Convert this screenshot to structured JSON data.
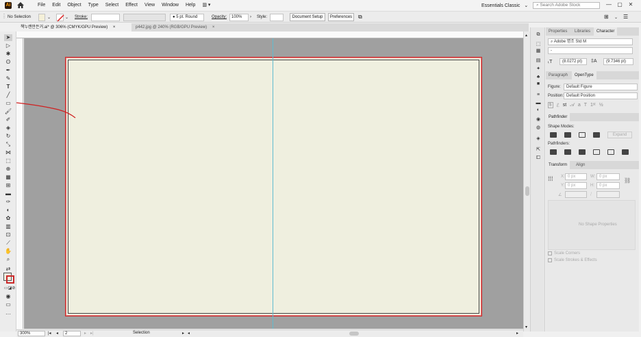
{
  "menubar": {
    "app_logo": "Ai",
    "items": [
      "File",
      "Edit",
      "Object",
      "Type",
      "Select",
      "Effect",
      "View",
      "Window",
      "Help"
    ],
    "workspace": "Essentials Classic",
    "search_placeholder": "Search Adobe Stock"
  },
  "controlbar": {
    "selection": "No Selection",
    "stroke_label": "Stroke:",
    "stroke_weight": "5 pt. Round",
    "opacity_label": "Opacity:",
    "opacity_value": "100%",
    "style_label": "Style:",
    "document_setup": "Document Setup",
    "preferences": "Preferences"
  },
  "tabs": [
    {
      "label": "책누캔만든거.ai* @ 306% (CMYK/GPU Preview)",
      "close": "×"
    },
    {
      "label": "p442.jpg @ 240% (RGB/GPU Preview)",
      "close": "×"
    }
  ],
  "status": {
    "zoom": "300%",
    "page": "2",
    "tool_name": "Selection"
  },
  "panels": {
    "top_tabs": [
      "Properties",
      "Libraries",
      "Character"
    ],
    "font_family": "Adobe 명조 Std M",
    "font_style": "-",
    "font_size": "(8.0272 pt)",
    "leading": "(9.7346 pt)",
    "opentype_tabs": [
      "Paragraph",
      "OpenType"
    ],
    "figure_label": "Figure:",
    "figure_value": "Default Figure",
    "position_label": "Position:",
    "position_value": "Default Position",
    "pathfinder_title": "Pathfinder",
    "shape_modes": "Shape Modes:",
    "expand": "Expand",
    "pathfinders": "Pathfinders:",
    "transform_tabs": [
      "Transform",
      "Align"
    ],
    "x_label": "X:",
    "x_value": "0 px",
    "y_label": "Y:",
    "y_value": "0 px",
    "w_label": "W:",
    "w_value": "0 px",
    "h_label": "H:",
    "h_value": "0 px",
    "no_shape": "No Shape Properties",
    "scale_corners": "Scale Corners",
    "scale_strokes": "Scale Strokes & Effects"
  },
  "colors": {
    "artboard": "#efefdf",
    "canvas": "#a0a0a0",
    "artboard_border": "#cc2a2a",
    "guide": "#5fbccf"
  }
}
